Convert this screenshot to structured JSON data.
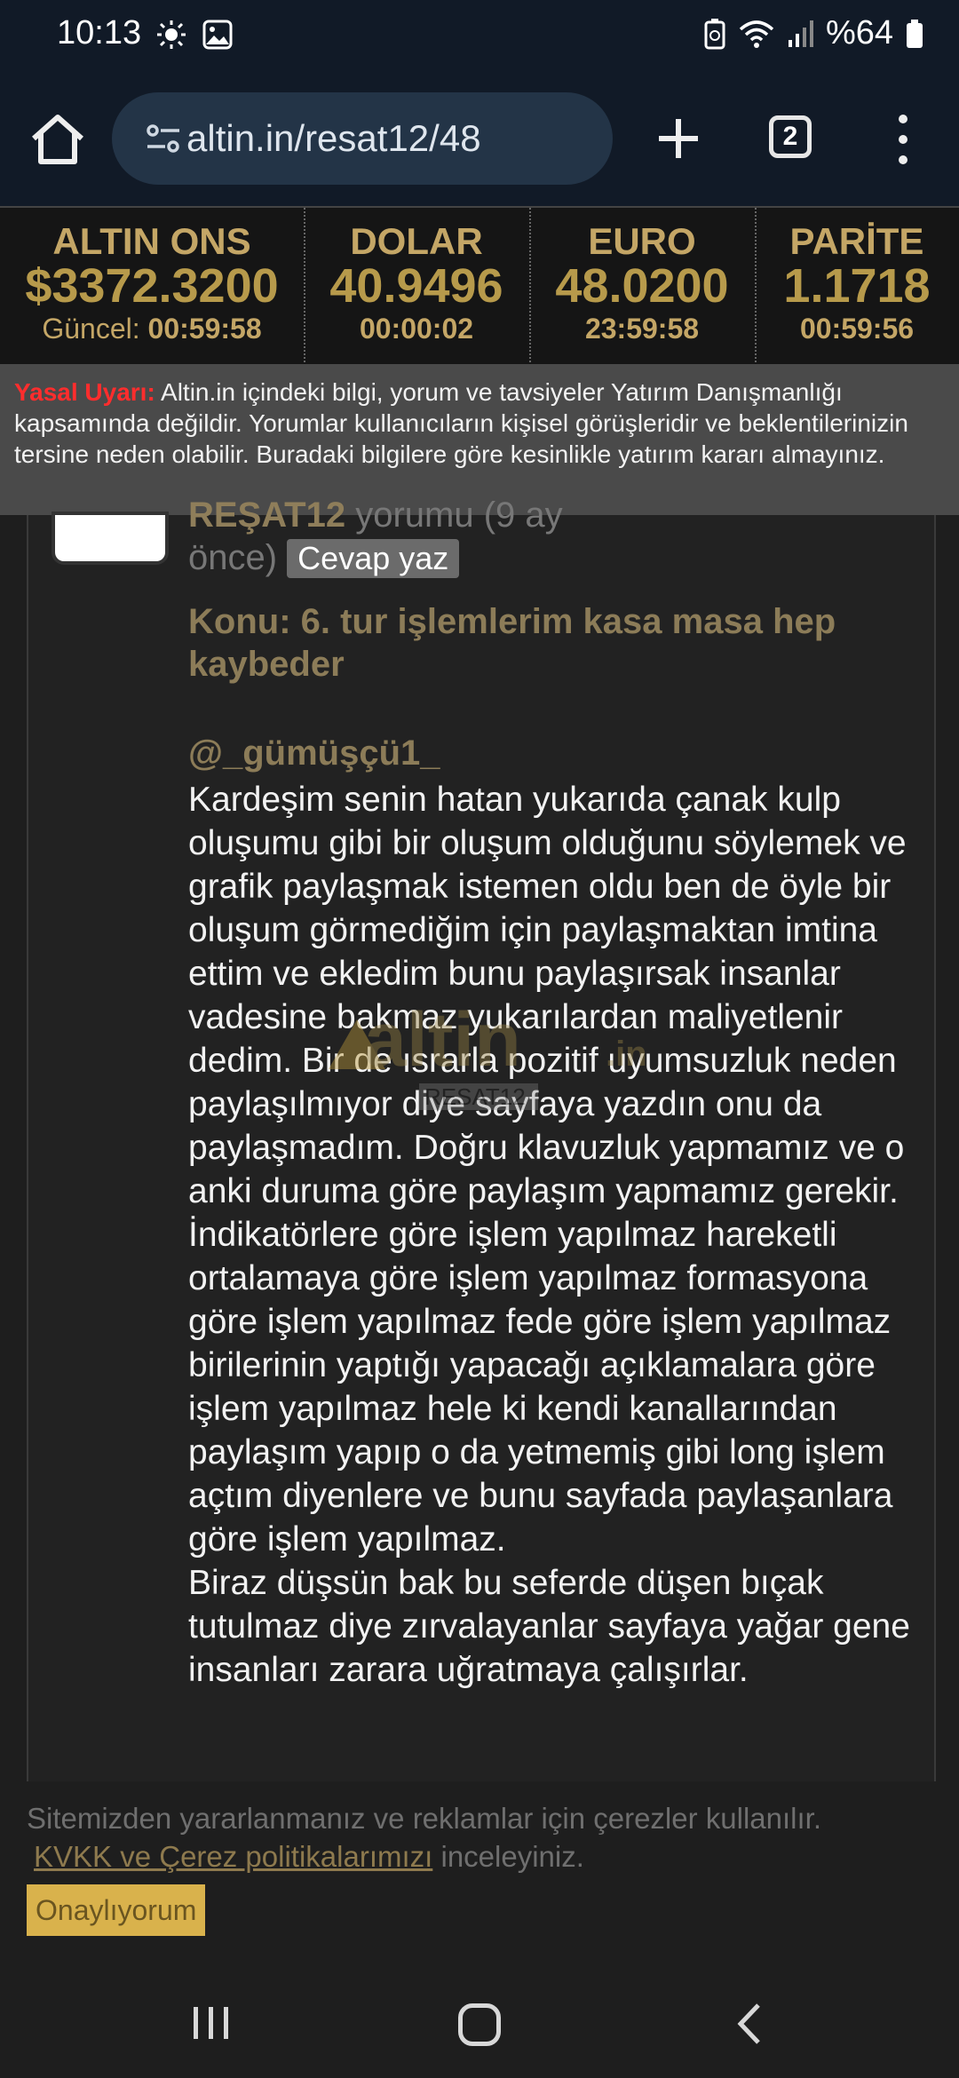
{
  "status_bar": {
    "time": "10:13",
    "battery": "%64"
  },
  "browser": {
    "url": "altin.in/resat12/48",
    "tab_count": "2"
  },
  "ticker": [
    {
      "name": "ALTIN ONS",
      "value": "$3372.3200",
      "time_label": "Güncel:",
      "time": "00:59:58"
    },
    {
      "name": "DOLAR",
      "value": "40.9496",
      "time_label": "",
      "time": "00:00:02"
    },
    {
      "name": "EURO",
      "value": "48.0200",
      "time_label": "",
      "time": "23:59:58"
    },
    {
      "name": "PARİTE",
      "value": "1.1718",
      "time_label": "",
      "time": "00:59:56"
    }
  ],
  "warning": {
    "label": "Yasal Uyarı:",
    "text": "Altin.in içindeki bilgi, yorum ve tavsiyeler Yatırım Danışmanlığı kapsamında değildir. Yorumlar kullanıcıların kişisel görüşleridir ve beklentilerinizin tersine neden olabilir. Buradaki bilgilere göre kesinlikle yatırım kararı almayınız."
  },
  "comment": {
    "author": "REŞAT12",
    "meta_a": " yorumu (9 ay",
    "meta_b": "önce) ",
    "reply_label": "Cevap yaz",
    "topic_label": "Konu:",
    "topic": "6. tur işlemlerim kasa masa hep kaybeder",
    "mention": "@_gümüşçü1_",
    "paragraph1": "Kardeşim senin hatan yukarıda çanak kulp oluşumu gibi bir oluşum olduğunu söylemek ve grafik paylaşmak istemen oldu ben de öyle bir oluşum görmediğim için paylaşmaktan imtina ettim ve ekledim bunu paylaşırsak insanlar vadesine bakmaz yukarılardan maliyetlenir dedim. Bir de ısrarla pozitif uyumsuzluk neden paylaşılmıyor diye sayfaya yazdın onu da paylaşmadım. Doğru klavuzluk yapmamız ve o anki duruma göre paylaşım yapmamız gerekir. İndikatörlere göre işlem yapılmaz hareketli ortalamaya göre işlem yapılmaz formasyona göre işlem yapılmaz fede göre işlem yapılmaz birilerinin yaptığı yapacağı açıklamalara göre işlem yapılmaz hele ki kendi kanallarından paylaşım yapıp o da yetmemiş gibi long işlem açtım diyenlere ve bunu sayfada paylaşanlara göre işlem yapılmaz.",
    "paragraph2": "Biraz düşsün bak bu seferde düşen bıçak tutulmaz diye zırvalayanlar sayfaya yağar gene insanları zarara uğratmaya çalışırlar."
  },
  "watermark": {
    "brand": "altin",
    "tld": ".in",
    "user": "RESAT12"
  },
  "cookie": {
    "text": "Sitemizden yararlanmanız ve reklamlar için çerezler kullanılır.",
    "link": "KVKK ve Çerez politikalarımızı",
    "suffix": " inceleyiniz.",
    "button": "Onaylıyorum"
  },
  "colors": {
    "gold": "#b79a4b",
    "warning_red": "#ff2d2d",
    "cookie_button": "#d9b24c"
  }
}
